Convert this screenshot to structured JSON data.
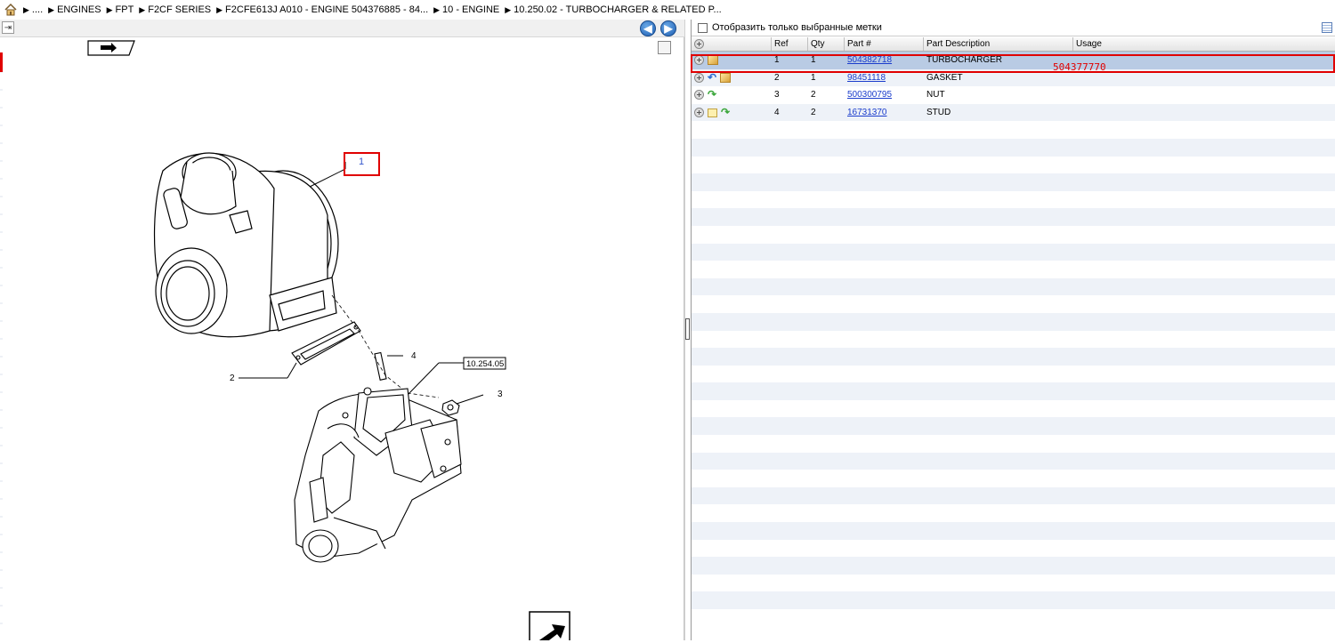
{
  "breadcrumb": [
    {
      "label": "...."
    },
    {
      "label": "ENGINES"
    },
    {
      "label": "FPT"
    },
    {
      "label": "F2CF SERIES"
    },
    {
      "label": "F2CFE613J A010 - ENGINE 504376885 - 84..."
    },
    {
      "label": "10 - ENGINE"
    },
    {
      "label": "10.250.02 - TURBOCHARGER & RELATED P..."
    }
  ],
  "left_panel": {
    "nav_back": "◀",
    "nav_forward": "▶",
    "callouts": {
      "c1": "1",
      "c2": "2",
      "c3": "3",
      "c4": "4",
      "ref_box": "10.254.05"
    }
  },
  "right_panel": {
    "filter_label": "Отобразить только выбранные метки",
    "columns": {
      "ref": "Ref",
      "qty": "Qty",
      "part": "Part #",
      "desc": "Part Description",
      "usage": "Usage"
    },
    "rows": [
      {
        "ref": "1",
        "qty": "1",
        "part": "504382718",
        "desc": "TURBOCHARGER",
        "usage": ""
      },
      {
        "ref": "2",
        "qty": "1",
        "part": "98451118",
        "desc": "GASKET",
        "usage": ""
      },
      {
        "ref": "3",
        "qty": "2",
        "part": "500300795",
        "desc": "NUT",
        "usage": ""
      },
      {
        "ref": "4",
        "qty": "2",
        "part": "16731370",
        "desc": "STUD",
        "usage": ""
      }
    ]
  },
  "annotation": {
    "text": "504377770",
    "color": "#e00000"
  },
  "colors": {
    "selected_row": "#b9cbe4",
    "link": "#1a3ccc",
    "alt_row": "#eef2f8"
  }
}
